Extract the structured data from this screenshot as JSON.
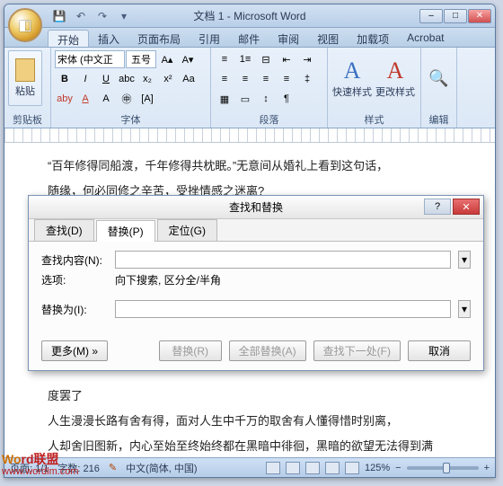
{
  "titlebar": {
    "title": "文档 1 - Microsoft Word"
  },
  "tabs": [
    "开始",
    "插入",
    "页面布局",
    "引用",
    "邮件",
    "审阅",
    "视图",
    "加载项",
    "Acrobat"
  ],
  "active_tab_index": 0,
  "ribbon": {
    "clipboard": {
      "paste": "粘贴",
      "label": "剪贴板"
    },
    "font": {
      "name": "宋体 (中文正",
      "size": "五号",
      "label": "字体"
    },
    "paragraph": {
      "label": "段落"
    },
    "styles": {
      "quick": "快速样式",
      "change": "更改样式",
      "label": "样式"
    },
    "editing": {
      "label": "编辑"
    }
  },
  "document": {
    "p1": "“百年修得同船渡，千年修得共枕眠。”无意间从婚礼上看到这句话，",
    "p2": "随缘，何必同修之辛苦，受挫情感之迷离?",
    "p3": "度罢了",
    "p4": "人生漫漫长路有舍有得，面对人生中千万的取舍有人懂得惜时别离，",
    "p5": "人却舍旧图新，内心至始至终始终都在黑暗中徘徊，黑暗的欲望无法得到满"
  },
  "dialog": {
    "title": "查找和替换",
    "tabs": {
      "find": "查找(D)",
      "replace": "替换(P)",
      "goto": "定位(G)"
    },
    "active_tab": 1,
    "find_label": "查找内容(N):",
    "options_label": "选项:",
    "options_value": "向下搜索, 区分全/半角",
    "replace_label": "替换为(I):",
    "buttons": {
      "more": "更多(M) »",
      "replace": "替换(R)",
      "replace_all": "全部替换(A)",
      "find_next": "查找下一处(F)",
      "cancel": "取消"
    }
  },
  "statusbar": {
    "page": "页面: 1/1",
    "words": "字数: 216",
    "lang": "中文(简体, 中国)",
    "zoom": "125%"
  },
  "watermark": {
    "brand1": "Wo",
    "brand2": "rd联盟",
    "url": "www.wordlm.com"
  }
}
